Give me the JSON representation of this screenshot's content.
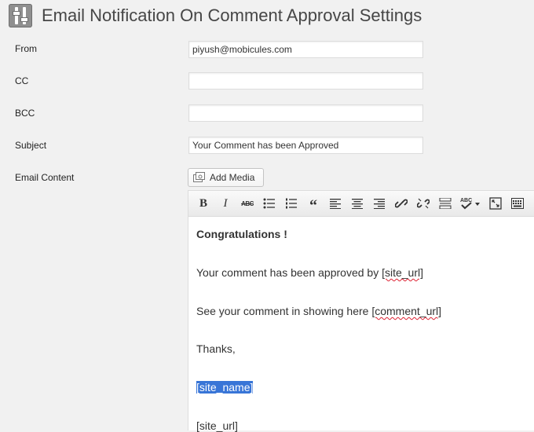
{
  "page": {
    "title": "Email Notification On Comment Approval Settings",
    "icon": "settings-sliders-icon"
  },
  "form": {
    "from": {
      "label": "From",
      "value": "piyush@mobicules.com"
    },
    "cc": {
      "label": "CC",
      "value": ""
    },
    "bcc": {
      "label": "BCC",
      "value": ""
    },
    "subject": {
      "label": "Subject",
      "value": "Your Comment has been Approved"
    },
    "email_content": {
      "label": "Email Content"
    }
  },
  "editor": {
    "add_media_label": "Add Media",
    "toolbar": [
      "bold-icon",
      "italic-icon",
      "strikethrough-icon",
      "bullet-list-icon",
      "numbered-list-icon",
      "blockquote-icon",
      "align-left-icon",
      "align-center-icon",
      "align-right-icon",
      "insert-link-icon",
      "unlink-icon",
      "read-more-icon",
      "spellcheck-icon",
      "fullscreen-icon",
      "toolbar-toggle-icon"
    ],
    "content": {
      "heading": "Congratulations !",
      "line1_prefix": "Your comment has been approved by ",
      "line1_token": "[site_url]",
      "line2_prefix": "See your comment in showing here ",
      "line2_token": "[comment_url]",
      "thanks": "Thanks,",
      "site_name_token": "[site_name]",
      "site_url_token": "[site_url]"
    }
  },
  "colors": {
    "background": "#f1f1f1",
    "selection": "#3875d7",
    "spellcheck_underline": "#dd2233"
  }
}
